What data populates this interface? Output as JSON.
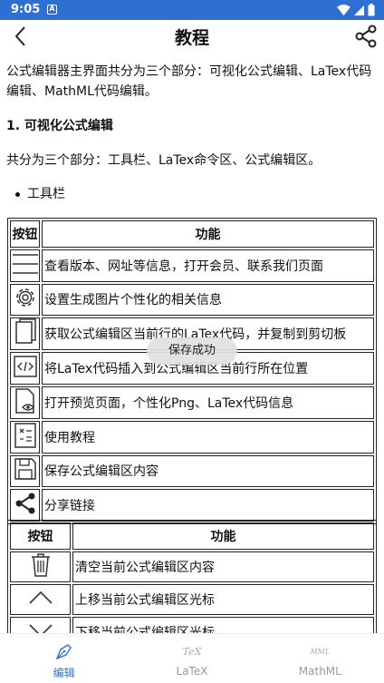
{
  "status_bar": {
    "time": "9:05",
    "notification_letter": "A"
  },
  "header": {
    "title": "教程",
    "back_icon": "chevron-left-icon",
    "share_icon": "share-icon"
  },
  "content": {
    "intro": "公式编辑器主界面共分为三个部分：可视化公式编辑、LaTex代码编辑、MathML代码编辑。",
    "section_title": "1. 可视化公式编辑",
    "section_desc": "共分为三个部分：工具栏、LaTex命令区、公式编辑区。",
    "bullet": "工具栏",
    "table1": {
      "headers": [
        "按钮",
        "功能"
      ],
      "rows": [
        {
          "icon": "menu-icon",
          "text": "查看版本、网址等信息，打开会员、联系我们页面"
        },
        {
          "icon": "gear-icon",
          "text": "设置生成图片个性化的相关信息"
        },
        {
          "icon": "copy-icon",
          "text": "获取公式编辑区当前行的LaTex代码，并复制到剪切板"
        },
        {
          "icon": "code-icon",
          "text": "将LaTex代码插入到公式编辑区当前行所在位置"
        },
        {
          "icon": "preview-icon",
          "text": "打开预览页面，个性化Png、LaTex代码信息"
        },
        {
          "icon": "tutorial-icon",
          "text": "使用教程"
        },
        {
          "icon": "save-icon",
          "text": "保存公式编辑区内容"
        },
        {
          "icon": "share-icon",
          "text": "分享链接"
        }
      ]
    },
    "table2": {
      "headers": [
        "按钮",
        "功能"
      ],
      "rows": [
        {
          "icon": "trash-icon",
          "text": "清空当前公式编辑区内容"
        },
        {
          "icon": "chevron-up-icon",
          "text": "上移当前公式编辑区光标"
        },
        {
          "icon": "chevron-down-icon",
          "text": "下移当前公式编辑区光标"
        }
      ]
    }
  },
  "toast": "保存成功",
  "bottom_nav": [
    {
      "label": "编辑",
      "icon": "pen-nib-icon",
      "active": true
    },
    {
      "label": "LaTeX",
      "icon_text": "TeX",
      "active": false
    },
    {
      "label": "MathML",
      "icon_text": "MML",
      "active": false
    }
  ],
  "colors": {
    "accent": "#2f6fd2",
    "inactive": "#9a9a9a"
  }
}
